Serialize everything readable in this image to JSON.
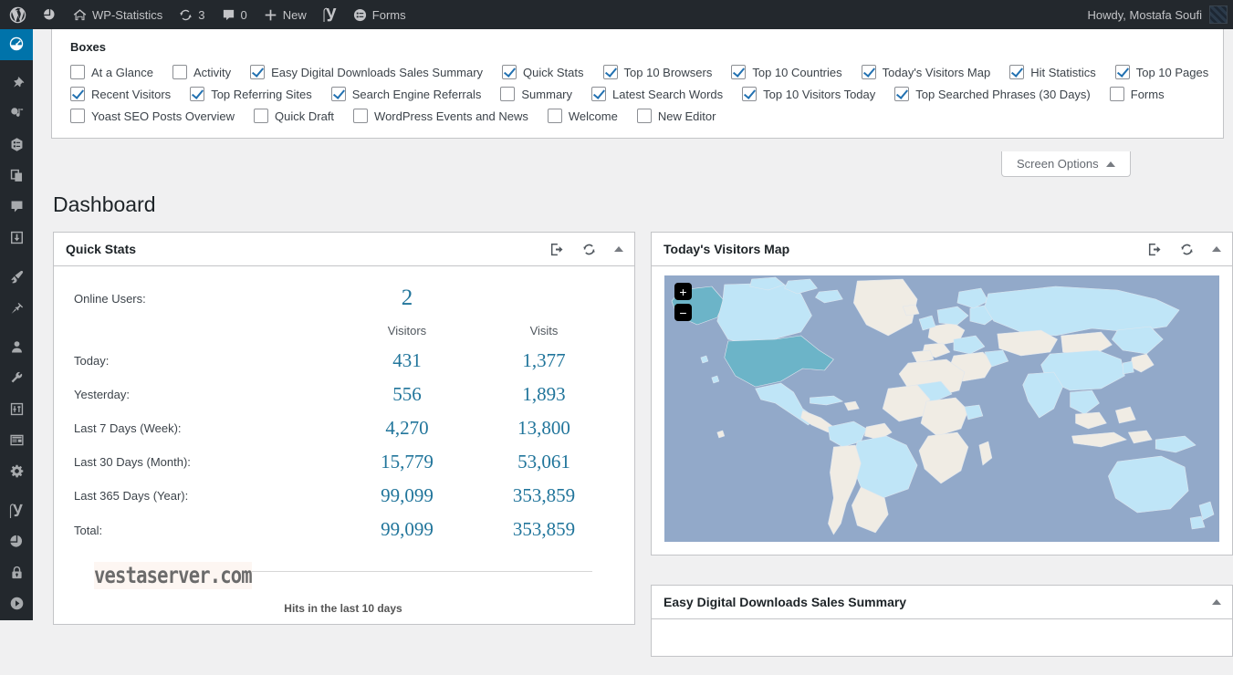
{
  "adminbar": {
    "items": [
      {
        "icon": "wordpress-logo-icon",
        "label": ""
      },
      {
        "icon": "pie-chart-icon",
        "label": ""
      },
      {
        "icon": "home-icon",
        "label": "WP-Statistics"
      },
      {
        "icon": "updates-icon",
        "label": "3"
      },
      {
        "icon": "comment-icon",
        "label": "0"
      },
      {
        "icon": "plus-icon",
        "label": "New"
      },
      {
        "icon": "yoast-icon",
        "label": ""
      },
      {
        "icon": "forms-icon",
        "label": "Forms"
      }
    ],
    "howdy": "Howdy, Mostafa Soufi"
  },
  "sidebar": {
    "items": [
      {
        "name": "dashboard",
        "icon": "dashboard-icon",
        "active": true
      },
      {
        "name": "posts",
        "icon": "pin-icon",
        "active": false
      },
      {
        "name": "media",
        "icon": "media-icon",
        "active": false
      },
      {
        "name": "forms",
        "icon": "forms-icon",
        "active": false
      },
      {
        "name": "pages",
        "icon": "pages-icon",
        "active": false
      },
      {
        "name": "comments",
        "icon": "comment-icon",
        "active": false
      },
      {
        "name": "downloads",
        "icon": "download-icon",
        "active": false
      },
      {
        "name": "appearance",
        "icon": "brush-icon",
        "active": false
      },
      {
        "name": "plugins",
        "icon": "plug-icon",
        "active": false
      },
      {
        "name": "users",
        "icon": "user-icon",
        "active": false
      },
      {
        "name": "tools",
        "icon": "wrench-icon",
        "active": false
      },
      {
        "name": "sliders",
        "icon": "sliders-icon",
        "active": false
      },
      {
        "name": "tables",
        "icon": "table-icon",
        "active": false
      },
      {
        "name": "settings",
        "icon": "gear-icon",
        "active": false
      },
      {
        "name": "yoast",
        "icon": "yoast-icon",
        "active": false
      },
      {
        "name": "wp-statistics",
        "icon": "pie-chart-icon",
        "active": false
      },
      {
        "name": "security",
        "icon": "lock-icon",
        "active": false
      },
      {
        "name": "media-player",
        "icon": "play-icon",
        "active": false
      }
    ]
  },
  "screen_options": {
    "heading": "Boxes",
    "tab_label": "Screen Options",
    "rows": [
      [
        {
          "label": "At a Glance",
          "checked": false
        },
        {
          "label": "Activity",
          "checked": false
        },
        {
          "label": "Easy Digital Downloads Sales Summary",
          "checked": true
        },
        {
          "label": "Quick Stats",
          "checked": true
        },
        {
          "label": "Top 10 Browsers",
          "checked": true
        },
        {
          "label": "Top 10 Countries",
          "checked": true
        },
        {
          "label": "Today's Visitors Map",
          "checked": true
        },
        {
          "label": "Hit Statistics",
          "checked": true
        },
        {
          "label": "Top 10 Pages",
          "checked": true
        }
      ],
      [
        {
          "label": "Recent Visitors",
          "checked": true
        },
        {
          "label": "Top Referring Sites",
          "checked": true
        },
        {
          "label": "Search Engine Referrals",
          "checked": true
        },
        {
          "label": "Summary",
          "checked": false
        },
        {
          "label": "Latest Search Words",
          "checked": true
        },
        {
          "label": "Top 10 Visitors Today",
          "checked": true
        },
        {
          "label": "Top Searched Phrases (30 Days)",
          "checked": true
        },
        {
          "label": "Forms",
          "checked": false
        }
      ],
      [
        {
          "label": "Yoast SEO Posts Overview",
          "checked": false
        },
        {
          "label": "Quick Draft",
          "checked": false
        },
        {
          "label": "WordPress Events and News",
          "checked": false
        },
        {
          "label": "Welcome",
          "checked": false
        },
        {
          "label": "New Editor",
          "checked": false
        }
      ]
    ]
  },
  "page": {
    "title": "Dashboard"
  },
  "quick_stats": {
    "title": "Quick Stats",
    "online_users_label": "Online Users:",
    "online_users_value": "2",
    "col_visitors": "Visitors",
    "col_visits": "Visits",
    "rows": [
      {
        "label": "Today:",
        "visitors": "431",
        "visits": "1,377"
      },
      {
        "label": "Yesterday:",
        "visitors": "556",
        "visits": "1,893"
      },
      {
        "label": "Last 7 Days (Week):",
        "visitors": "4,270",
        "visits": "13,800"
      },
      {
        "label": "Last 30 Days (Month):",
        "visitors": "15,779",
        "visits": "53,061"
      },
      {
        "label": "Last 365 Days (Year):",
        "visitors": "99,099",
        "visits": "353,859"
      },
      {
        "label": "Total:",
        "visitors": "99,099",
        "visits": "353,859"
      }
    ],
    "chart_watermark": "vestaserver.com",
    "chart_caption": "Hits in the last 10 days"
  },
  "visitors_map": {
    "title": "Today's Visitors Map",
    "zoom_in": "+",
    "zoom_out": "−"
  },
  "edd_summary": {
    "title": "Easy Digital Downloads Sales Summary"
  },
  "colors": {
    "admin_bar_bg": "#23282d",
    "sidebar_active": "#0073aa",
    "accent_blue": "#21759b",
    "checkbox_check": "#2271b1",
    "map_ocean": "#92a9c9",
    "map_land_light": "#f0ece4",
    "map_land_blue": "#bfe5f7",
    "map_land_teal": "#6cb4c8"
  }
}
